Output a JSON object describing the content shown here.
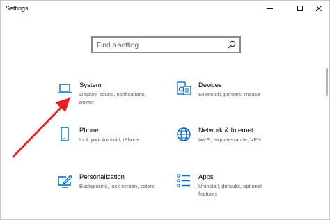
{
  "window": {
    "title": "Settings",
    "controls": {
      "minimize": "—",
      "maximize": "☐",
      "close": "✕"
    }
  },
  "search": {
    "placeholder": "Find a setting",
    "value": ""
  },
  "categories": [
    {
      "name": "System",
      "description": "Display, sound, notifications, power",
      "icon": "laptop-icon"
    },
    {
      "name": "Devices",
      "description": "Bluetooth, printers, mouse",
      "icon": "devices-icon"
    },
    {
      "name": "Phone",
      "description": "Link your Android, iPhone",
      "icon": "phone-icon"
    },
    {
      "name": "Network & Internet",
      "description": "Wi-Fi, airplane mode, VPN",
      "icon": "globe-icon"
    },
    {
      "name": "Personalization",
      "description": "Background, lock screen, colors",
      "icon": "personalization-icon"
    },
    {
      "name": "Apps",
      "description": "Uninstall, defaults, optional features",
      "icon": "apps-icon"
    }
  ],
  "colors": {
    "accent": "#0067c0",
    "annotation_arrow": "#e8202a"
  }
}
